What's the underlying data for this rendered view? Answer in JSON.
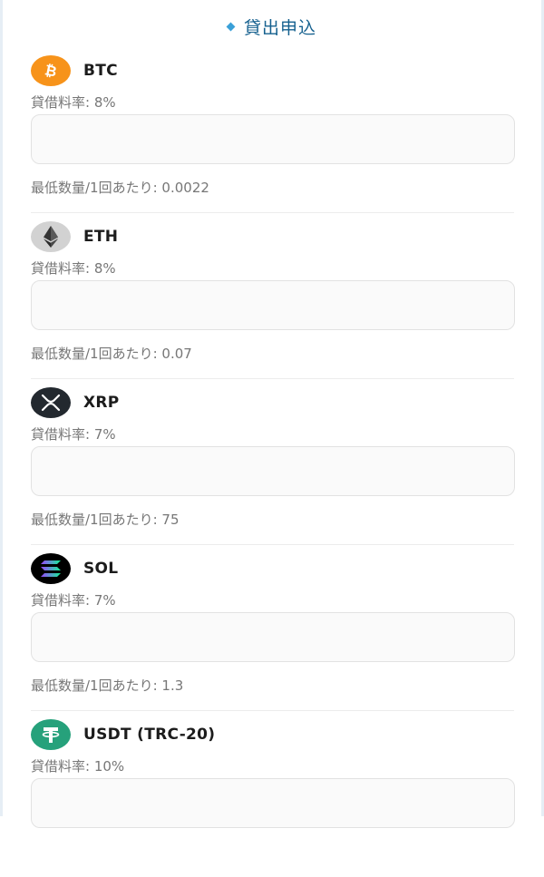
{
  "header": {
    "title": "貸出申込",
    "accent_color": "#3aa0d8",
    "title_color": "#16618f"
  },
  "coins": [
    {
      "symbol": "BTC",
      "icon": "bitcoin-icon",
      "icon_color": "#f7931a",
      "rate": "貸借料率: 8%",
      "input_value": "",
      "min_qty": "最低数量/1回あたり: 0.0022"
    },
    {
      "symbol": "ETH",
      "icon": "ethereum-icon",
      "icon_color": "#d2d2d2",
      "rate": "貸借料率: 8%",
      "input_value": "",
      "min_qty": "最低数量/1回あたり: 0.07"
    },
    {
      "symbol": "XRP",
      "icon": "xrp-icon",
      "icon_color": "#23292f",
      "rate": "貸借料率: 7%",
      "input_value": "",
      "min_qty": "最低数量/1回あたり: 75"
    },
    {
      "symbol": "SOL",
      "icon": "solana-icon",
      "icon_color": "#000000",
      "rate": "貸借料率: 7%",
      "input_value": "",
      "min_qty": "最低数量/1回あたり: 1.3"
    },
    {
      "symbol": "USDT (TRC-20)",
      "icon": "tether-icon",
      "icon_color": "#26a17b",
      "rate": "貸借料率: 10%",
      "input_value": ""
    }
  ]
}
